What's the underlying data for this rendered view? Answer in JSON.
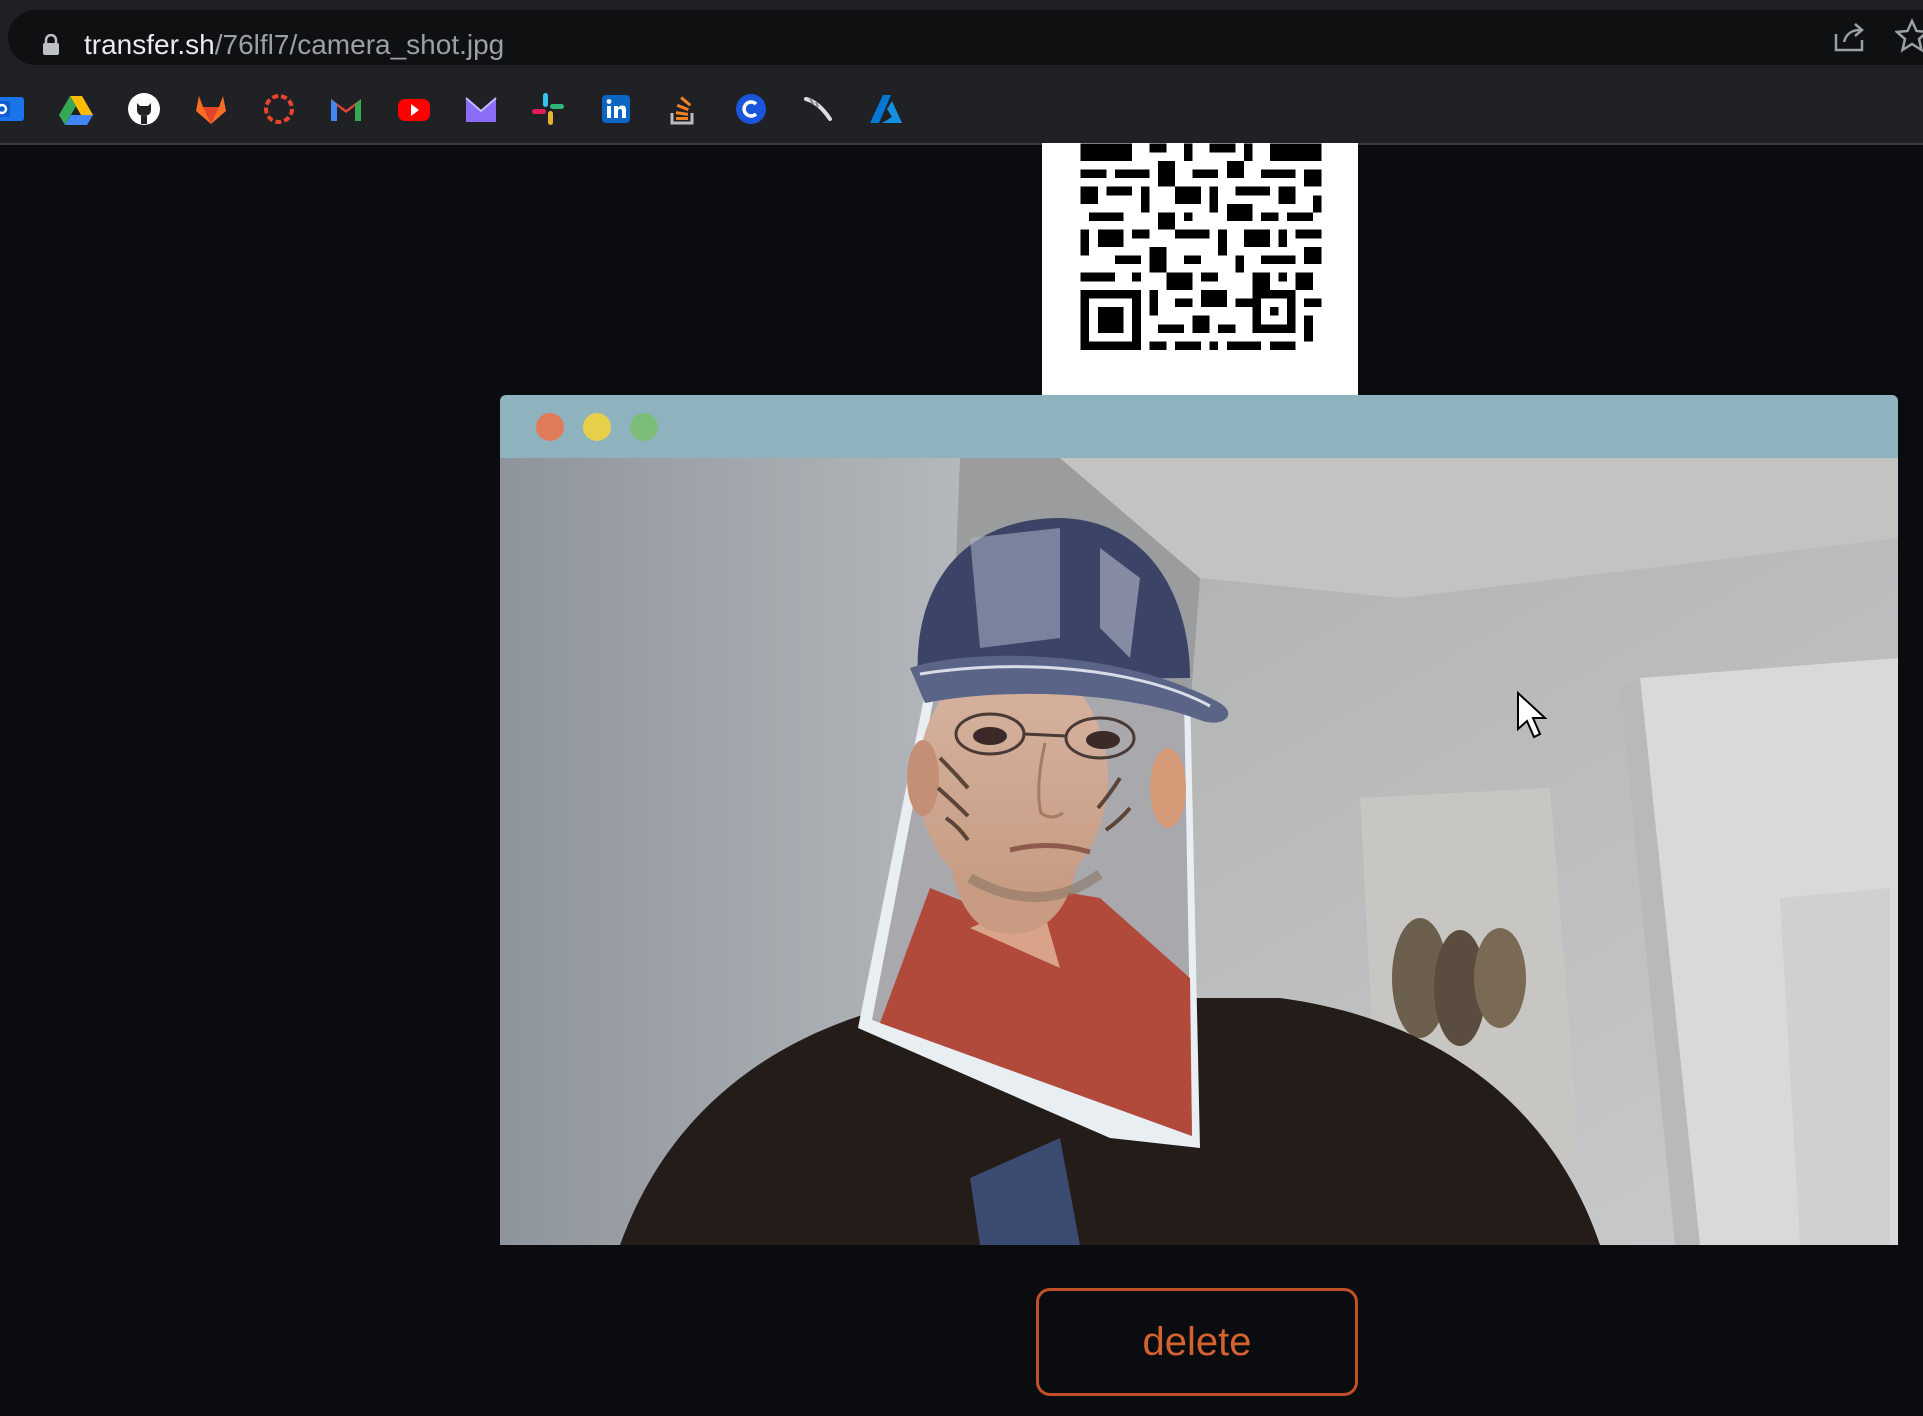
{
  "browser": {
    "url_host": "transfer.sh",
    "url_path": "/76lfl7/camera_shot.jpg",
    "bookmarks": [
      {
        "icon": "outlook-icon",
        "color": "#1a73e8"
      },
      {
        "icon": "google-drive-icon",
        "color": "#fbbc04"
      },
      {
        "icon": "github-icon",
        "color": "#ffffff"
      },
      {
        "icon": "gitlab-icon",
        "color": "#fc6d26"
      },
      {
        "icon": "circle-ring-icon",
        "color": "#e8452c"
      },
      {
        "icon": "gmail-icon",
        "color": "#ea4335"
      },
      {
        "icon": "youtube-icon",
        "color": "#ff0000"
      },
      {
        "icon": "proton-mail-icon",
        "color": "#8b6cf7"
      },
      {
        "icon": "slack-icon",
        "color": "#36c5f0"
      },
      {
        "icon": "linkedin-icon",
        "color": "#0a66c2"
      },
      {
        "icon": "stackoverflow-icon",
        "color": "#f48024"
      },
      {
        "icon": "c-circle-icon",
        "color": "#1a56db"
      },
      {
        "icon": "feather-icon",
        "color": "#dddddd"
      },
      {
        "icon": "azure-icon",
        "color": "#0078d4"
      }
    ]
  },
  "page": {
    "qr_code_icon": "qr-code",
    "photo_window_controls": [
      "close",
      "minimize",
      "maximize"
    ],
    "delete_label": "delete",
    "accent_color": "#d4622f"
  }
}
